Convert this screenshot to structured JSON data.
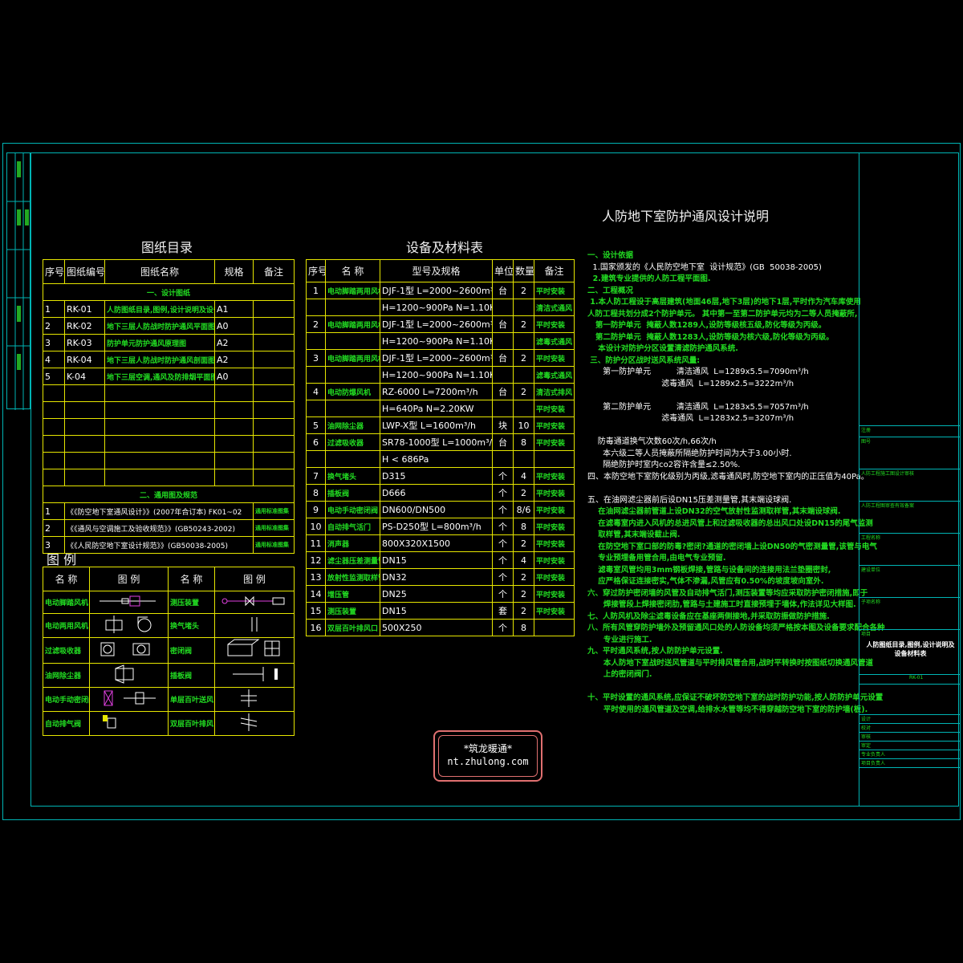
{
  "main_title": "人防地下室防护通风设计说明",
  "drawing_list": {
    "title": "图纸目录",
    "headers": [
      "序号",
      "图纸编号",
      "图纸名称",
      "规格",
      "备注"
    ],
    "section1": "一、设计图纸",
    "rows": [
      [
        "1",
        "RK-01",
        "人防图纸目录,图例,设计说明及设备材料表",
        "A1",
        ""
      ],
      [
        "2",
        "RK-02",
        "地下三层人防战时防护通风平面图",
        "A0",
        ""
      ],
      [
        "3",
        "RK-03",
        "防护单元防护通风原理图",
        "A2",
        ""
      ],
      [
        "4",
        "RK-04",
        "地下三层人防战时防护通风剖面图",
        "A2",
        ""
      ],
      [
        "5",
        "K-04",
        "地下三层空调,通风及防排烟平面图",
        "A0",
        ""
      ]
    ],
    "section2": "二、通用图及规范",
    "std_rows": [
      [
        "1",
        "《《防空地下室通风设计》》(2007年合订本) FK01~02",
        "通用标准图集"
      ],
      [
        "2",
        "《《通风与空调施工及验收规范》》(GB50243-2002)",
        "通用标准图集"
      ],
      [
        "3",
        "《《人民防空地下室设计规范》》(GB50038-2005)",
        "通用标准图集"
      ]
    ]
  },
  "legend": {
    "title": "图    例",
    "headers": [
      "名  称",
      "图  例",
      "名  称",
      "图  例"
    ],
    "rows": [
      [
        "电动脚踏风机",
        "测压装置"
      ],
      [
        "电动两用风机",
        "换气堵头"
      ],
      [
        "过滤吸收器",
        "密闭阀"
      ],
      [
        "油网除尘器",
        "插板阀"
      ],
      [
        "电动手动密闭阀",
        "单层百叶送风口"
      ],
      [
        "自动排气阀",
        "双层百叶排风口"
      ]
    ]
  },
  "equipment": {
    "title": "设备及材料表",
    "headers": [
      "序号",
      "名  称",
      "型号及规格",
      "单位",
      "数量",
      "备注"
    ],
    "rows": [
      [
        "1",
        "电动脚踏两用风机",
        "DJF-1型 L=2000~2600m³/h",
        "台",
        "2",
        "平时安装"
      ],
      [
        "",
        "",
        "H=1200~900Pa N=1.10KW",
        "",
        "",
        "清洁式通风"
      ],
      [
        "2",
        "电动脚踏两用风机",
        "DJF-1型 L=2000~2600m³/h",
        "台",
        "2",
        "平时安装"
      ],
      [
        "",
        "",
        "H=1200~900Pa N=1.10KW",
        "",
        "",
        "滤毒式通风"
      ],
      [
        "3",
        "电动脚踏两用风机",
        "DJF-1型 L=2000~2600m³/h",
        "台",
        "2",
        "平时安装"
      ],
      [
        "",
        "",
        "H=1200~900Pa N=1.10KW",
        "",
        "",
        "滤毒式通风"
      ],
      [
        "4",
        "电动防爆风机",
        "RZ-6000     L=7200m³/h",
        "台",
        "2",
        "清洁式排风"
      ],
      [
        "",
        "",
        "H=640Pa   N=2.20KW",
        "",
        "",
        "平时安装"
      ],
      [
        "5",
        "油网除尘器",
        "LWP-X型  L=1600m³/h",
        "块",
        "10",
        "平时安装"
      ],
      [
        "6",
        "过滤吸收器",
        "SR78-1000型  L=1000m³/h",
        "台",
        "8",
        "平时安装"
      ],
      [
        "",
        "",
        "H < 686Pa",
        "",
        "",
        ""
      ],
      [
        "7",
        "换气堵头",
        "D315",
        "个",
        "4",
        "平时安装"
      ],
      [
        "8",
        "插板阀",
        "D666",
        "个",
        "2",
        "平时安装"
      ],
      [
        "9",
        "电动手动密闭阀",
        "DN600/DN500",
        "个",
        "8/6",
        "平时安装"
      ],
      [
        "10",
        "自动排气活门",
        "PS-D250型  L=800m³/h",
        "个",
        "8",
        "平时安装"
      ],
      [
        "11",
        "消声器",
        "800X320X1500",
        "个",
        "2",
        "平时安装"
      ],
      [
        "12",
        "滤尘器压差测量管",
        "DN15",
        "个",
        "4",
        "平时安装"
      ],
      [
        "13",
        "放射性监测取样管",
        "DN32",
        "个",
        "2",
        "平时安装"
      ],
      [
        "14",
        "增压管",
        "DN25",
        "个",
        "2",
        "平时安装"
      ],
      [
        "15",
        "测压装置",
        "DN15",
        "套",
        "2",
        "平时安装"
      ],
      [
        "16",
        "双层百叶排风口",
        "500X250",
        "个",
        "8",
        ""
      ]
    ]
  },
  "notes": [
    {
      "t": "一、设计依据",
      "c": "g"
    },
    {
      "t": "  1.国家颁发的《人民防空地下室  设计规范》(GB  50038-2005)",
      "c": "w"
    },
    {
      "t": "  2.建筑专业提供的人防工程平面图.",
      "c": "g"
    },
    {
      "t": "二、工程概况",
      "c": "g"
    },
    {
      "t": " 1.本人防工程设于高层建筑(地面46层,地下3层)的地下1层,平时作为汽车库使用",
      "c": "g"
    },
    {
      "t": "人防工程共划分成2个防护单元。 其中第一至第二防护单元均为二等人员掩蔽所,",
      "c": "g"
    },
    {
      "t": "   第一防护单元  掩蔽人数1289人,设防等级核五级,防化等级为丙级。",
      "c": "g"
    },
    {
      "t": "   第二防护单元  掩蔽人数1283人,设防等级为核六级,防化等级为丙级。",
      "c": "g"
    },
    {
      "t": "    本设计对防护分区设置清滤防护通风系统.",
      "c": "g"
    },
    {
      "t": " 三、防护分区战时送风系统风量:",
      "c": "g"
    },
    {
      "t": "      第一防护单元          清洁通风  L=1289x5.5=7090m³/h",
      "c": "w"
    },
    {
      "t": "                             滤毒通风  L=1289x2.5=3222m³/h",
      "c": "w"
    },
    {
      "t": "",
      "c": "w"
    },
    {
      "t": "      第二防护单元          清洁通风  L=1283x5.5=7057m³/h",
      "c": "w"
    },
    {
      "t": "                             滤毒通风  L=1283x2.5=3207m³/h",
      "c": "w"
    },
    {
      "t": "",
      "c": "w"
    },
    {
      "t": "    防毒通道换气次数60次/h,66次/h",
      "c": "w"
    },
    {
      "t": "      本六级二等人员掩蔽所隔绝防护时间为大于3.00小时.",
      "c": "w"
    },
    {
      "t": "      隔绝防护时室内co2容许含量≤2.50%.",
      "c": "w"
    },
    {
      "t": "四、本防空地下室防化级别为丙级,滤毒通风时,防空地下室内的正压值为40Pa。",
      "c": "w"
    },
    {
      "t": "",
      "c": "w"
    },
    {
      "t": "五、在油网滤尘器前后设DN15压差测量管,其末端设球阀.",
      "c": "w"
    },
    {
      "t": "    在油网滤尘器前管道上设DN32的空气放射性监测取样管,其末端设球阀.",
      "c": "g"
    },
    {
      "t": "    在滤毒室内进入风机的总进风管上和过滤吸收器的总出风口处设DN15的尾气监测",
      "c": "g"
    },
    {
      "t": "    取样管,其末端设截止阀.",
      "c": "g"
    },
    {
      "t": "    在防空地下室口部的防毒?密闭?通道的密闭墙上设DN50的气密测量管,该管与电气",
      "c": "g"
    },
    {
      "t": "    专业预埋备用管合用,由电气专业预留.",
      "c": "g"
    },
    {
      "t": "    滤毒室风管均用3mm钢板焊接,管路与设备间的连接用法兰垫圈密封,",
      "c": "g"
    },
    {
      "t": "    应严格保证连接密实,气体不渗漏,风管应有0.50%的坡度坡向室外.",
      "c": "g"
    },
    {
      "t": "六、穿过防护密闭墙的风管及自动排气活门,测压装置等均应采取防护密闭措施,即于",
      "c": "g"
    },
    {
      "t": "      焊接管段上焊接密闭肋,管路与土建施工时直接预埋于墙体,作法详见大样图.",
      "c": "g"
    },
    {
      "t": "七、人防风机及除尘滤毒设备应在基座两侧接地,并采取防振做防护措施.",
      "c": "g"
    },
    {
      "t": "八、所有风管穿防护墙外及预留通风口处的人防设备均须严格按本图及设备要求配合各种",
      "c": "g"
    },
    {
      "t": "      专业进行施工.",
      "c": "g"
    },
    {
      "t": "九、平时通风系统,按人防防护单元设置.",
      "c": "g"
    },
    {
      "t": "      本人防地下室战时送风管道与平时排风管合用,战时平转换时按图纸切换通风管道",
      "c": "g"
    },
    {
      "t": "      上的密闭阀门.",
      "c": "g"
    },
    {
      "t": "",
      "c": "w"
    },
    {
      "t": "十、平时设置的通风系统,应保证不破坏防空地下室的战时防护功能,按人防防护单元设置",
      "c": "g"
    },
    {
      "t": "      平时使用的通风管道及空调,给排水水管等均不得穿越防空地下室的防护墙(板).",
      "c": "g"
    }
  ],
  "title_block": {
    "project_title": "人防图纸目录,图例,设计说明及设备材料表",
    "drawing_no": "RK-01",
    "rows": [
      "注册",
      "图号",
      "人防工程施工图设计审核",
      "人防工程图审查有效备案",
      "工程名称",
      "建设单位",
      "子项名称",
      "项目",
      "设计",
      "校对",
      "审核",
      "审定",
      "专业负责人",
      "项目负责人"
    ]
  },
  "stamp": {
    "line1": "*筑龙暖通*",
    "line2": "nt.zhulong.com"
  },
  "colors": {
    "frame": "#00b4b4",
    "table": "#e6e600",
    "text": "#ffffff",
    "annotation": "#22dd22"
  }
}
